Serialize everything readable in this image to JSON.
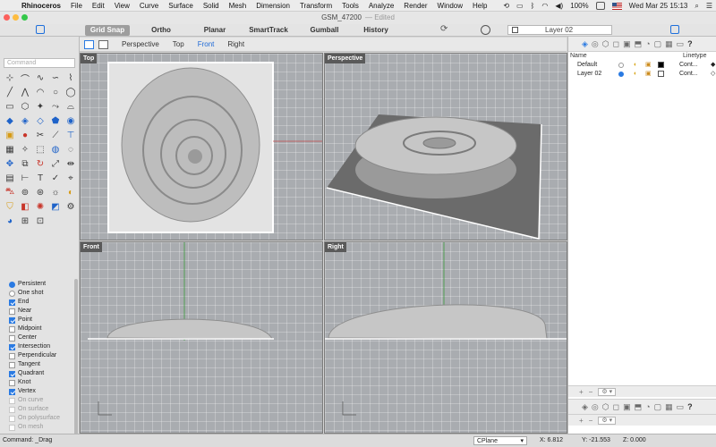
{
  "menubar": {
    "apple_glyph": "",
    "items": [
      "Rhinoceros",
      "File",
      "Edit",
      "View",
      "Curve",
      "Surface",
      "Solid",
      "Mesh",
      "Dimension",
      "Transform",
      "Tools",
      "Analyze",
      "Render",
      "Window",
      "Help"
    ],
    "battery": "100%",
    "datetime": "Wed Mar 25  15:13"
  },
  "window": {
    "title": "GSM_47200",
    "title_suffix": "— Edited"
  },
  "toolbar": {
    "buttons": [
      {
        "label": "Grid Snap",
        "active": true
      },
      {
        "label": "Ortho",
        "active": false
      },
      {
        "label": "Planar",
        "active": false
      },
      {
        "label": "SmartTrack",
        "active": false
      },
      {
        "label": "Gumball",
        "active": false
      },
      {
        "label": "History",
        "active": false
      }
    ],
    "current_layer": "Layer 02"
  },
  "left_panel": {
    "command_placeholder": "Command",
    "options": [
      {
        "label": "Persistent",
        "type": "radio",
        "checked": true,
        "enabled": true
      },
      {
        "label": "One shot",
        "type": "radio",
        "checked": false,
        "enabled": true
      },
      {
        "label": "End",
        "type": "check",
        "checked": true,
        "enabled": true
      },
      {
        "label": "Near",
        "type": "check",
        "checked": false,
        "enabled": true
      },
      {
        "label": "Point",
        "type": "check",
        "checked": true,
        "enabled": true
      },
      {
        "label": "Midpoint",
        "type": "check",
        "checked": false,
        "enabled": true
      },
      {
        "label": "Center",
        "type": "check",
        "checked": false,
        "enabled": true
      },
      {
        "label": "Intersection",
        "type": "check",
        "checked": true,
        "enabled": true
      },
      {
        "label": "Perpendicular",
        "type": "check",
        "checked": false,
        "enabled": true
      },
      {
        "label": "Tangent",
        "type": "check",
        "checked": false,
        "enabled": true
      },
      {
        "label": "Quadrant",
        "type": "check",
        "checked": true,
        "enabled": true
      },
      {
        "label": "Knot",
        "type": "check",
        "checked": false,
        "enabled": true
      },
      {
        "label": "Vertex",
        "type": "check",
        "checked": true,
        "enabled": true
      },
      {
        "label": "On curve",
        "type": "check",
        "checked": false,
        "enabled": false
      },
      {
        "label": "On surface",
        "type": "check",
        "checked": false,
        "enabled": false
      },
      {
        "label": "On polysurface",
        "type": "check",
        "checked": false,
        "enabled": false
      },
      {
        "label": "On mesh",
        "type": "check",
        "checked": false,
        "enabled": false
      }
    ]
  },
  "viewport_tabs": {
    "tabs": [
      "Perspective",
      "Top",
      "Front",
      "Right"
    ],
    "selected": "Front"
  },
  "viewports": {
    "top": "Top",
    "perspective": "Perspective",
    "front": "Front",
    "right": "Right"
  },
  "layers_panel": {
    "col_name": "Name",
    "col_linetype": "Linetype",
    "rows": [
      {
        "name": "Default",
        "current": false,
        "color": "#000000",
        "linetype": "Cont..."
      },
      {
        "name": "Layer 02",
        "current": true,
        "color": "#ffffff",
        "linetype": "Cont..."
      }
    ]
  },
  "status": {
    "command": "Command: _Drag",
    "cplane": "CPlane",
    "x": "X: 6.812",
    "y": "Y: -21.553",
    "z": "Z: 0.000"
  }
}
